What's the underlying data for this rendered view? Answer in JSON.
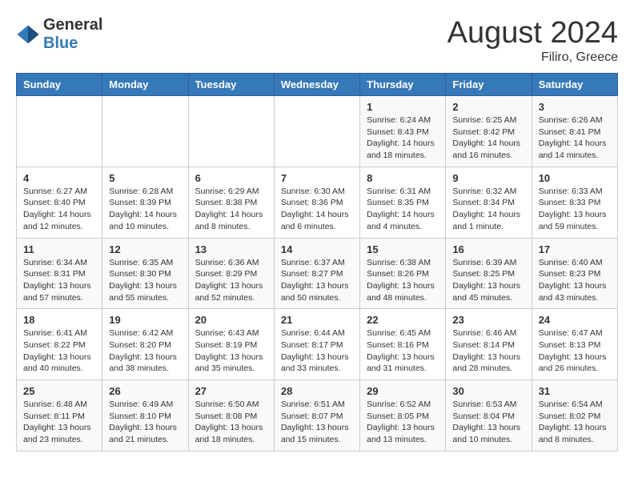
{
  "header": {
    "logo_general": "General",
    "logo_blue": "Blue",
    "month_year": "August 2024",
    "location": "Filiro, Greece"
  },
  "days_of_week": [
    "Sunday",
    "Monday",
    "Tuesday",
    "Wednesday",
    "Thursday",
    "Friday",
    "Saturday"
  ],
  "weeks": [
    [
      {
        "day": "",
        "sunrise": "",
        "sunset": "",
        "daylight": ""
      },
      {
        "day": "",
        "sunrise": "",
        "sunset": "",
        "daylight": ""
      },
      {
        "day": "",
        "sunrise": "",
        "sunset": "",
        "daylight": ""
      },
      {
        "day": "",
        "sunrise": "",
        "sunset": "",
        "daylight": ""
      },
      {
        "day": "1",
        "sunrise": "Sunrise: 6:24 AM",
        "sunset": "Sunset: 8:43 PM",
        "daylight": "Daylight: 14 hours and 18 minutes."
      },
      {
        "day": "2",
        "sunrise": "Sunrise: 6:25 AM",
        "sunset": "Sunset: 8:42 PM",
        "daylight": "Daylight: 14 hours and 16 minutes."
      },
      {
        "day": "3",
        "sunrise": "Sunrise: 6:26 AM",
        "sunset": "Sunset: 8:41 PM",
        "daylight": "Daylight: 14 hours and 14 minutes."
      }
    ],
    [
      {
        "day": "4",
        "sunrise": "Sunrise: 6:27 AM",
        "sunset": "Sunset: 8:40 PM",
        "daylight": "Daylight: 14 hours and 12 minutes."
      },
      {
        "day": "5",
        "sunrise": "Sunrise: 6:28 AM",
        "sunset": "Sunset: 8:39 PM",
        "daylight": "Daylight: 14 hours and 10 minutes."
      },
      {
        "day": "6",
        "sunrise": "Sunrise: 6:29 AM",
        "sunset": "Sunset: 8:38 PM",
        "daylight": "Daylight: 14 hours and 8 minutes."
      },
      {
        "day": "7",
        "sunrise": "Sunrise: 6:30 AM",
        "sunset": "Sunset: 8:36 PM",
        "daylight": "Daylight: 14 hours and 6 minutes."
      },
      {
        "day": "8",
        "sunrise": "Sunrise: 6:31 AM",
        "sunset": "Sunset: 8:35 PM",
        "daylight": "Daylight: 14 hours and 4 minutes."
      },
      {
        "day": "9",
        "sunrise": "Sunrise: 6:32 AM",
        "sunset": "Sunset: 8:34 PM",
        "daylight": "Daylight: 14 hours and 1 minute."
      },
      {
        "day": "10",
        "sunrise": "Sunrise: 6:33 AM",
        "sunset": "Sunset: 8:33 PM",
        "daylight": "Daylight: 13 hours and 59 minutes."
      }
    ],
    [
      {
        "day": "11",
        "sunrise": "Sunrise: 6:34 AM",
        "sunset": "Sunset: 8:31 PM",
        "daylight": "Daylight: 13 hours and 57 minutes."
      },
      {
        "day": "12",
        "sunrise": "Sunrise: 6:35 AM",
        "sunset": "Sunset: 8:30 PM",
        "daylight": "Daylight: 13 hours and 55 minutes."
      },
      {
        "day": "13",
        "sunrise": "Sunrise: 6:36 AM",
        "sunset": "Sunset: 8:29 PM",
        "daylight": "Daylight: 13 hours and 52 minutes."
      },
      {
        "day": "14",
        "sunrise": "Sunrise: 6:37 AM",
        "sunset": "Sunset: 8:27 PM",
        "daylight": "Daylight: 13 hours and 50 minutes."
      },
      {
        "day": "15",
        "sunrise": "Sunrise: 6:38 AM",
        "sunset": "Sunset: 8:26 PM",
        "daylight": "Daylight: 13 hours and 48 minutes."
      },
      {
        "day": "16",
        "sunrise": "Sunrise: 6:39 AM",
        "sunset": "Sunset: 8:25 PM",
        "daylight": "Daylight: 13 hours and 45 minutes."
      },
      {
        "day": "17",
        "sunrise": "Sunrise: 6:40 AM",
        "sunset": "Sunset: 8:23 PM",
        "daylight": "Daylight: 13 hours and 43 minutes."
      }
    ],
    [
      {
        "day": "18",
        "sunrise": "Sunrise: 6:41 AM",
        "sunset": "Sunset: 8:22 PM",
        "daylight": "Daylight: 13 hours and 40 minutes."
      },
      {
        "day": "19",
        "sunrise": "Sunrise: 6:42 AM",
        "sunset": "Sunset: 8:20 PM",
        "daylight": "Daylight: 13 hours and 38 minutes."
      },
      {
        "day": "20",
        "sunrise": "Sunrise: 6:43 AM",
        "sunset": "Sunset: 8:19 PM",
        "daylight": "Daylight: 13 hours and 35 minutes."
      },
      {
        "day": "21",
        "sunrise": "Sunrise: 6:44 AM",
        "sunset": "Sunset: 8:17 PM",
        "daylight": "Daylight: 13 hours and 33 minutes."
      },
      {
        "day": "22",
        "sunrise": "Sunrise: 6:45 AM",
        "sunset": "Sunset: 8:16 PM",
        "daylight": "Daylight: 13 hours and 31 minutes."
      },
      {
        "day": "23",
        "sunrise": "Sunrise: 6:46 AM",
        "sunset": "Sunset: 8:14 PM",
        "daylight": "Daylight: 13 hours and 28 minutes."
      },
      {
        "day": "24",
        "sunrise": "Sunrise: 6:47 AM",
        "sunset": "Sunset: 8:13 PM",
        "daylight": "Daylight: 13 hours and 26 minutes."
      }
    ],
    [
      {
        "day": "25",
        "sunrise": "Sunrise: 6:48 AM",
        "sunset": "Sunset: 8:11 PM",
        "daylight": "Daylight: 13 hours and 23 minutes."
      },
      {
        "day": "26",
        "sunrise": "Sunrise: 6:49 AM",
        "sunset": "Sunset: 8:10 PM",
        "daylight": "Daylight: 13 hours and 21 minutes."
      },
      {
        "day": "27",
        "sunrise": "Sunrise: 6:50 AM",
        "sunset": "Sunset: 8:08 PM",
        "daylight": "Daylight: 13 hours and 18 minutes."
      },
      {
        "day": "28",
        "sunrise": "Sunrise: 6:51 AM",
        "sunset": "Sunset: 8:07 PM",
        "daylight": "Daylight: 13 hours and 15 minutes."
      },
      {
        "day": "29",
        "sunrise": "Sunrise: 6:52 AM",
        "sunset": "Sunset: 8:05 PM",
        "daylight": "Daylight: 13 hours and 13 minutes."
      },
      {
        "day": "30",
        "sunrise": "Sunrise: 6:53 AM",
        "sunset": "Sunset: 8:04 PM",
        "daylight": "Daylight: 13 hours and 10 minutes."
      },
      {
        "day": "31",
        "sunrise": "Sunrise: 6:54 AM",
        "sunset": "Sunset: 8:02 PM",
        "daylight": "Daylight: 13 hours and 8 minutes."
      }
    ]
  ]
}
